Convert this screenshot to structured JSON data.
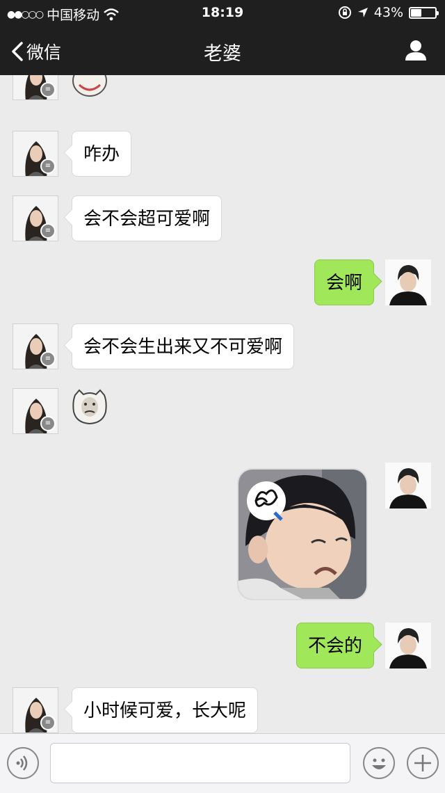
{
  "status_bar": {
    "carrier": "中国移动",
    "time": "18:19",
    "battery": "43%",
    "battery_level": 0.43
  },
  "nav": {
    "back_label": "微信",
    "title": "老婆"
  },
  "messages": [
    {
      "side": "left",
      "type": "sticker-partial"
    },
    {
      "side": "left",
      "type": "text",
      "text": "咋办"
    },
    {
      "side": "left",
      "type": "text",
      "text": "会不会超可爱啊"
    },
    {
      "side": "right",
      "type": "text",
      "text": "会啊"
    },
    {
      "side": "left",
      "type": "text",
      "text": "会不会生出来又不可爱啊"
    },
    {
      "side": "left",
      "type": "sticker"
    },
    {
      "side": "right",
      "type": "image"
    },
    {
      "side": "right",
      "type": "text",
      "text": "不会的"
    },
    {
      "side": "left",
      "type": "text",
      "text": "小时候可爱，长大呢"
    }
  ],
  "input": {
    "placeholder": ""
  },
  "icons": {
    "back": "chevron-left-icon",
    "profile": "person-icon",
    "voice": "voice-icon",
    "emoji": "emoji-icon",
    "plus": "plus-icon"
  },
  "colors": {
    "header_bg": "#1f1f20",
    "chat_bg": "#ebebeb",
    "my_bubble": "#a0e75a",
    "their_bubble": "#ffffff"
  }
}
